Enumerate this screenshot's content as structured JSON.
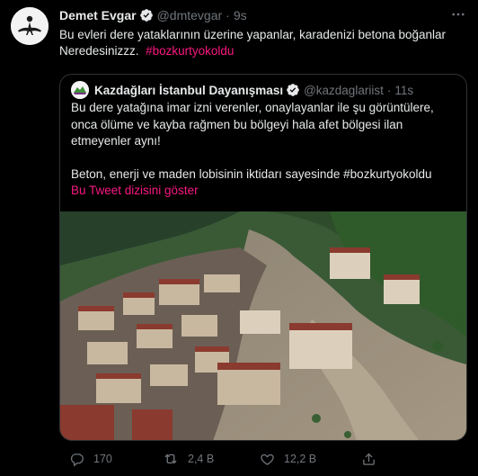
{
  "colors": {
    "background": "#000000",
    "text": "#e7e9ea",
    "muted": "#71767b",
    "hashtag": "#f91880",
    "verified": "#e7e9ea",
    "border": "#2f3336"
  },
  "tweet": {
    "author_name": "Demet Evgar",
    "handle": "@dmtevgar",
    "separator": "·",
    "time": "9s",
    "text": "Bu evleri dere yataklarının üzerine yapanlar, karadenizi betona boğanlar Neredesinizzz.",
    "hashtag": "#bozkurtyokoldu",
    "icons": {
      "avatar": "profile-photo",
      "verified": "verified-badge-icon",
      "more": "more-dots-icon"
    }
  },
  "quote": {
    "author_name": "Kazdağları İstanbul Dayanışması",
    "handle": "@kazdaglariist",
    "separator": "·",
    "time": "11s",
    "paragraph1": "Bu dere yatağına imar izni verenler, onaylayanlar ile şu görüntülere, onca ölüme ve kayba rağmen bu bölgeyi hala afet bölgesi ilan etmeyenler aynı!",
    "paragraph2": "Beton, enerji ve maden lobisinin iktidarı sayesinde #bozkurtyokoldu",
    "show_thread": "Bu Tweet dizisini göster",
    "photo": "aerial-flood-photo"
  },
  "actions": {
    "reply_count": "170",
    "retweet_count": "2,4 B",
    "like_count": "12,2 B",
    "icons": [
      "reply-icon",
      "retweet-icon",
      "like-icon",
      "share-icon"
    ]
  }
}
